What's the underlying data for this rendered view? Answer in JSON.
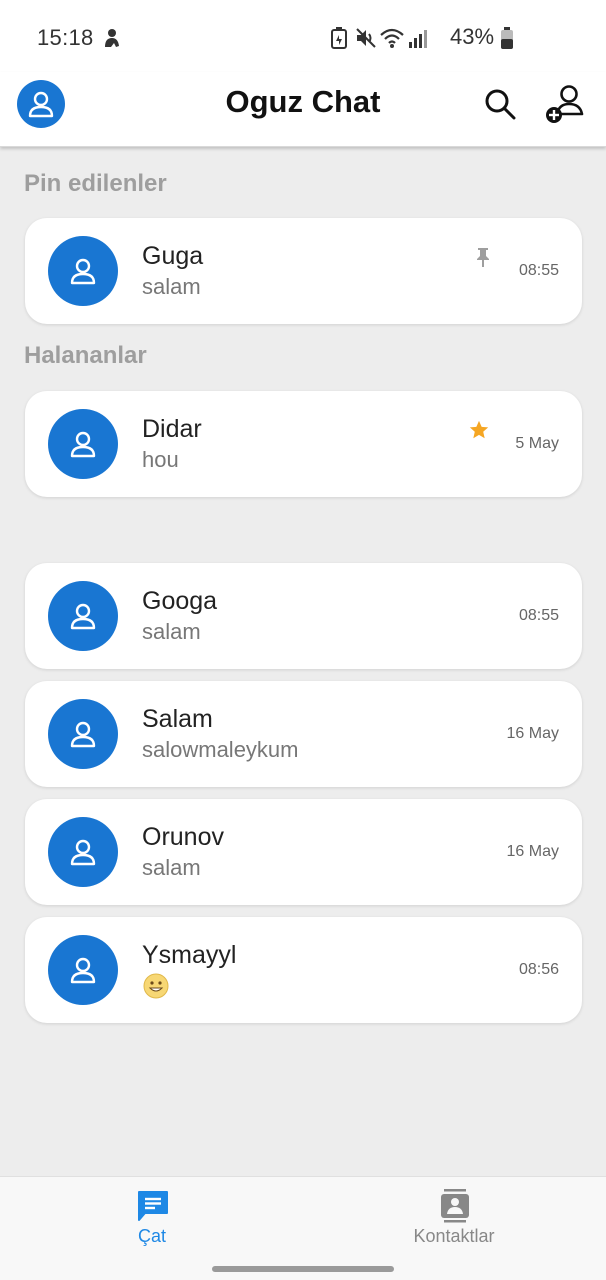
{
  "status_bar": {
    "time": "15:18",
    "battery_percent": "43%",
    "icons": [
      "notification-icon",
      "battery-saver-icon",
      "mute-icon",
      "wifi-icon",
      "signal-icon",
      "battery-icon"
    ]
  },
  "app_bar": {
    "title": "Oguz Chat",
    "icons": [
      "profile-icon",
      "search-icon",
      "add-contact-icon"
    ]
  },
  "sections": {
    "pinned_title": "Pin edilenler",
    "favorites_title": "Halananlar"
  },
  "chats": {
    "pinned": [
      {
        "name": "Guga",
        "message": "salam",
        "time": "08:55",
        "marker_icon": "pin-icon"
      }
    ],
    "favorites": [
      {
        "name": "Didar",
        "message": "hou",
        "time": "5 May",
        "marker_icon": "star-icon"
      }
    ],
    "others": [
      {
        "name": "Googa",
        "message": "salam",
        "time": "08:55"
      },
      {
        "name": "Salam",
        "message": "salowmaleykum",
        "time": "16 May"
      },
      {
        "name": "Orunov",
        "message": "salam",
        "time": "16 May"
      },
      {
        "name": "Ysmayyl",
        "message": "",
        "message_icon": "smiley-emoji-icon",
        "time": "08:56"
      }
    ]
  },
  "bottom_nav": {
    "items": [
      {
        "label": "Çat",
        "icon": "chat-icon",
        "active": true
      },
      {
        "label": "Kontaktlar",
        "icon": "contacts-icon",
        "active": false
      }
    ]
  },
  "colors": {
    "accent": "#1976d2",
    "active_nav": "#1e88e5",
    "star": "#f5a623",
    "background": "#ededed",
    "section_title": "#9e9e9e"
  }
}
